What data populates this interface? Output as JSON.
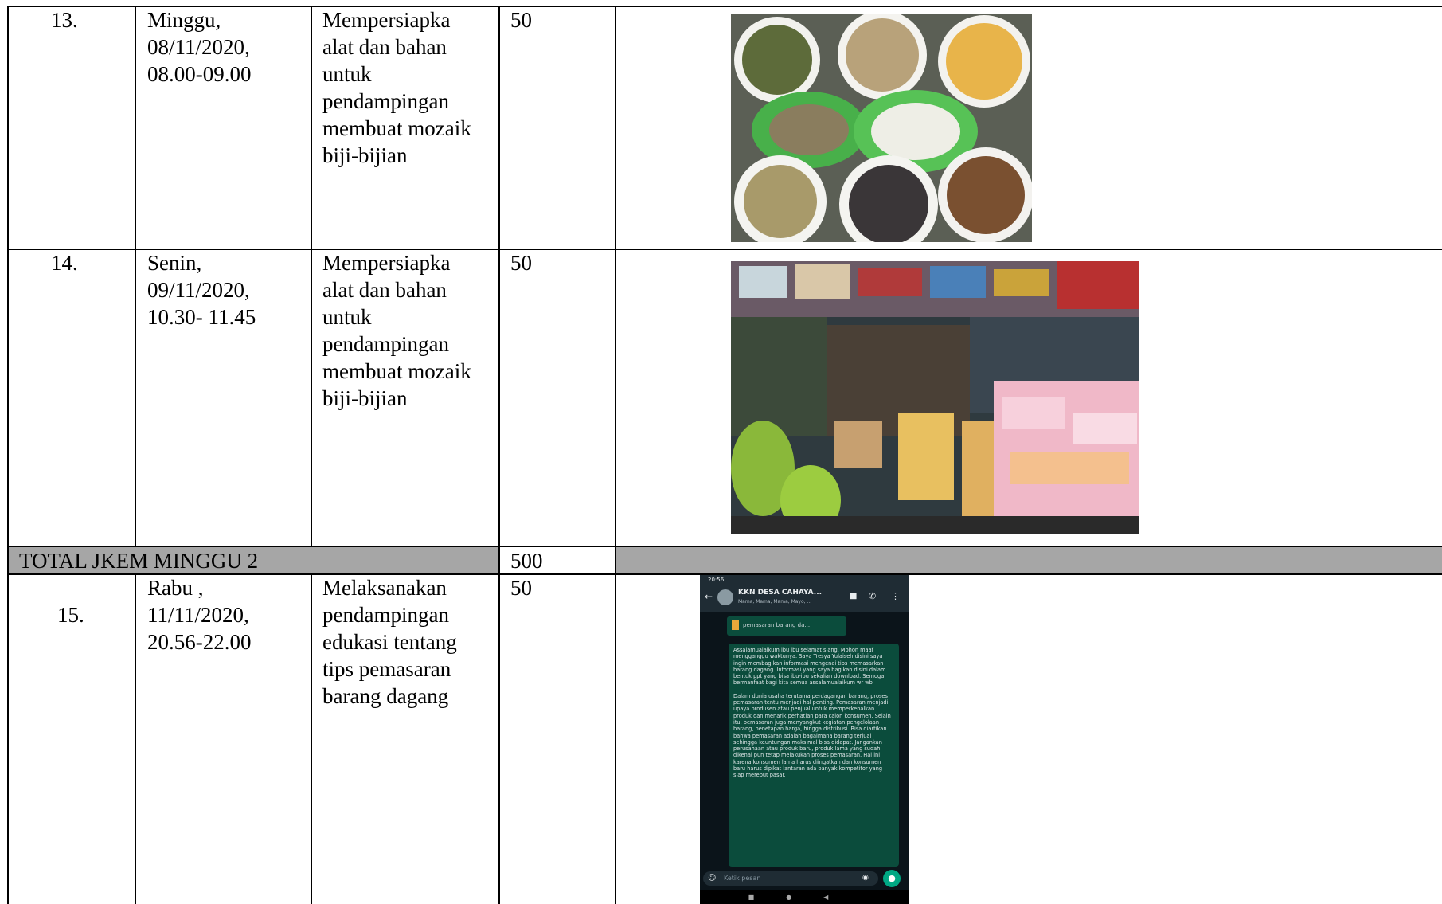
{
  "rows": [
    {
      "no": "13.",
      "date": "Minggu,\n08/11/2020,\n08.00-09.00",
      "activity": "Mempersiapka\nalat dan bahan\nuntuk\npendampingan\nmembuat mozaik\nbiji-bijian",
      "jkem": "50"
    },
    {
      "no": "14.",
      "date": "Senin,\n09/11/2020,\n10.30- 11.45",
      "activity": "Mempersiapka\nalat dan bahan\nuntuk\npendampingan\nmembuat mozaik\nbiji-bijian",
      "jkem": "50"
    },
    {
      "no": "15.",
      "date": "Rabu ,\n11/11/2020,\n20.56-22.00",
      "activity": "Melaksanakan\npendampingan\nedukasi tentang\ntips pemasaran\nbarang dagang",
      "jkem": "50"
    }
  ],
  "total": {
    "label": "TOTAL JKEM MINGGU 2",
    "value": "500"
  },
  "chat": {
    "time": "20:56",
    "group_title": "KKN DESA CAHAYA...",
    "members": "Mama, Mama, Mama, Mayo, ...",
    "doc_label": "pemasaran barang da...",
    "para1": "Assalamualaikum ibu ibu selamat siang. Mohon maaf mengganggu waktunya. Saya Tresya Yulaiseh disini saya ingin membagikan informasi mengenai tips memasarkan barang dagang. Informasi yang saya bagikan disini dalam bentuk ppt yang bisa ibu-ibu sekalian download. Semoga bermanfaat bagi kita semua assalamualaikum wr wb",
    "para2": "Dalam dunia usaha terutama perdagangan barang, proses pemasaran tentu menjadi hal penting. Pemasaran menjadi upaya produsen atau penjual untuk memperkenalkan produk dan menarik perhatian para calon konsumen. Selain itu, pemasaran juga menyangkut kegiatan pengelolaan barang, penetapan harga, hingga distribusi. Bisa diartikan bahwa pemasaran adalah bagaimana barang terjual sehingga keuntungan maksimal bisa didapat. Jangankan perusahaan atau produk baru, produk lama yang sudah dikenal pun tetap melakukan proses pemasaran. Hal ini karena konsumen lama harus diingatkan dan konsumen baru harus dipikat lantaran ada banyak kompetitor yang siap merebut pasar.",
    "input_placeholder": "Ketik pesan"
  },
  "colors": {
    "total_row_bg": "#a6a6a6",
    "border": "#000000",
    "chat_bubble": "#0b4c3c",
    "chat_bg": "#0b141a",
    "chat_header": "#1f2c34",
    "mic_button": "#00a884"
  }
}
